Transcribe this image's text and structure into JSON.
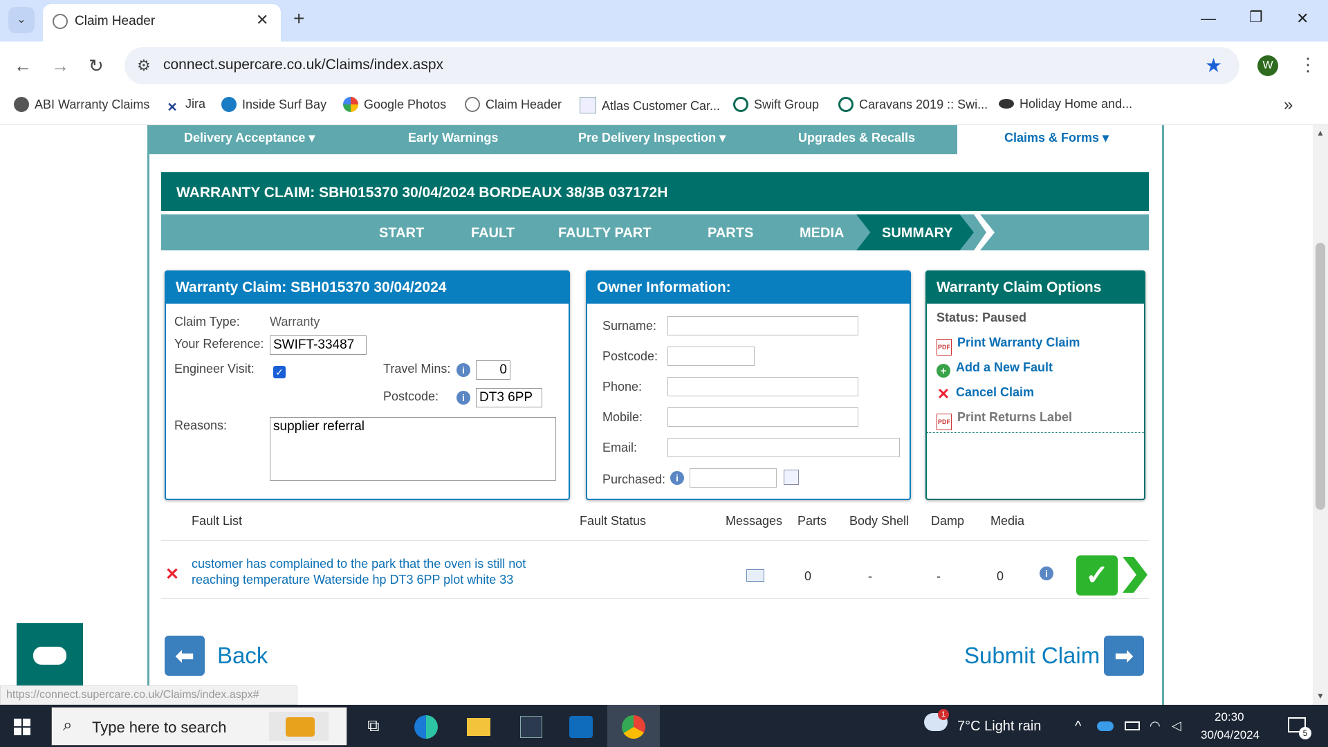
{
  "browser": {
    "tab_title": "Claim Header",
    "tab_close": "✕",
    "new_tab": "+",
    "url": "connect.supercare.co.uk/Claims/index.aspx",
    "profile_initial": "W",
    "bookmarks": [
      "ABI Warranty Claims",
      "Jira",
      "Inside Surf Bay",
      "Google Photos",
      "Claim Header",
      "Atlas Customer Car...",
      "Swift Group",
      "Caravans 2019 :: Swi...",
      "Holiday Home and..."
    ],
    "status_url": "https://connect.supercare.co.uk/Claims/index.aspx#"
  },
  "topnav": {
    "items": [
      "Delivery Acceptance ▾",
      "Early Warnings",
      "Pre Delivery Inspection ▾",
      "Upgrades & Recalls",
      "Claims & Forms ▾"
    ]
  },
  "claim": {
    "header": "WARRANTY CLAIM: SBH015370 30/04/2024 BORDEAUX 38/3B 037172H",
    "steps": [
      "START",
      "FAULT",
      "FAULTY PART",
      "PARTS",
      "MEDIA",
      "SUMMARY"
    ],
    "active_step": "SUMMARY"
  },
  "claim_panel": {
    "title": "Warranty Claim: SBH015370 30/04/2024",
    "claim_type_label": "Claim Type:",
    "claim_type_value": "Warranty",
    "reference_label": "Your Reference:",
    "reference_value": "SWIFT-33487",
    "engineer_visit_label": "Engineer Visit:",
    "engineer_visit_checked": true,
    "travel_mins_label": "Travel Mins:",
    "travel_mins_value": "0",
    "postcode_label": "Postcode:",
    "postcode_value": "DT3 6PP",
    "reasons_label": "Reasons:",
    "reasons_value": "supplier referral"
  },
  "owner_panel": {
    "title": "Owner Information:",
    "surname_label": "Surname:",
    "postcode_label": "Postcode:",
    "phone_label": "Phone:",
    "mobile_label": "Mobile:",
    "email_label": "Email:",
    "purchased_label": "Purchased:"
  },
  "options_panel": {
    "title": "Warranty Claim Options",
    "status": "Status: Paused",
    "links": [
      "Print Warranty Claim",
      "Add a New Fault",
      "Cancel Claim",
      "Print Returns Label"
    ]
  },
  "fault_table": {
    "headers": [
      "Fault List",
      "Fault Status",
      "Messages",
      "Parts",
      "Body Shell",
      "Damp",
      "Media"
    ],
    "rows": [
      {
        "description": "customer has complained to the park that the oven is still not reaching temperature Waterside hp DT3 6PP plot white 33",
        "parts": "0",
        "body_shell": "-",
        "damp": "-",
        "media": "0"
      }
    ]
  },
  "actions": {
    "back_label": "Back",
    "submit_label": "Submit Claim"
  },
  "taskbar": {
    "search_placeholder": "Type here to search",
    "weather_badge": "1",
    "weather": "7°C  Light rain",
    "time": "20:30",
    "date": "30/04/2024",
    "notifications": "5"
  },
  "colors": {
    "teal_dark": "#00716a",
    "teal_light": "#5fa9ae",
    "blue_panel": "#0a7fbf",
    "link_blue": "#0a6fb5"
  }
}
